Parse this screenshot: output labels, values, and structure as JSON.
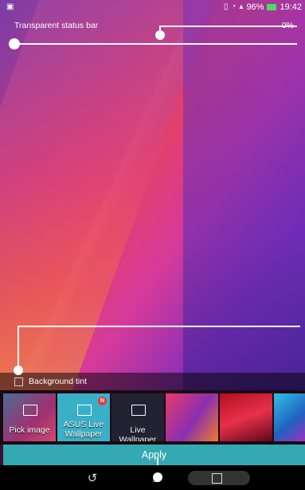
{
  "status_bar": {
    "left_icon": "image-icon",
    "battery_pct": "96%",
    "time": "19:42",
    "icons": [
      "vibrate-icon",
      "wifi-icon",
      "sim-icon",
      "battery-charging-icon"
    ]
  },
  "header": {
    "title": "Transparent status bar",
    "percent": "0%",
    "transparency_fraction": 0.0
  },
  "tint": {
    "label": "Background tint",
    "checked": false
  },
  "wallpapers": {
    "items": [
      {
        "label": "Pick image",
        "icon": "image-icon"
      },
      {
        "label": "ASUS Live Wallpaper",
        "icon": "image-icon",
        "badge": "N"
      },
      {
        "label": "Live Wallpaper",
        "icon": "image-icon"
      },
      {
        "label": ""
      },
      {
        "label": ""
      },
      {
        "label": ""
      }
    ]
  },
  "apply_label": "Apply",
  "nav": {
    "back": "back-icon",
    "home": "home-icon",
    "recent": "recents-icon"
  },
  "colors": {
    "accent": "#33a9b3",
    "badge": "#e53935"
  }
}
